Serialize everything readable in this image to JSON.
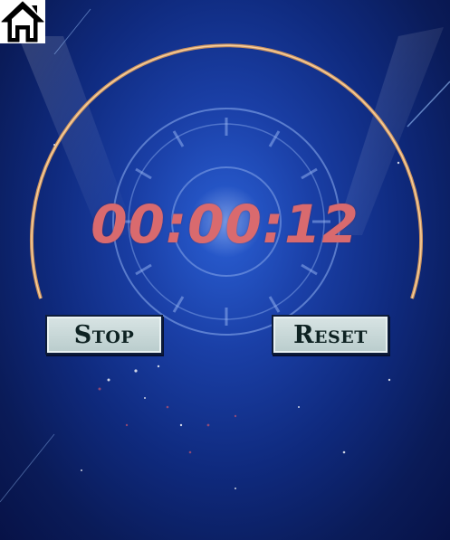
{
  "timer": {
    "display": "00:00:12"
  },
  "controls": {
    "stop_label": "Stop",
    "reset_label": "Reset"
  },
  "icons": {
    "home": "home-icon"
  },
  "colors": {
    "timer_text": "#d96a6e",
    "button_face": "#c8d8d8",
    "background": "#1a3fa6"
  }
}
